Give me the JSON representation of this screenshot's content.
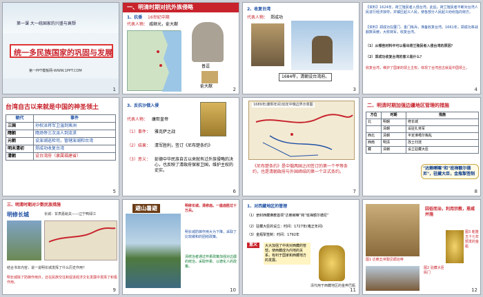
{
  "s1": {
    "lesson": "第一课  大一统国家的兴盛与衰颓",
    "title": "统一多民族国家的巩固与发展",
    "footer": "第一PPT模板网-WWW.1PPT.COM",
    "num": "1"
  },
  "s2": {
    "header": "一、明清时期对抗外族侵略",
    "item": "1、抗倭",
    "date": "16世纪中期",
    "rep_label": "代表人物：",
    "rep": "戚继光，俞大猷",
    "cap1": "普逗",
    "cap2": "俞大猷",
    "num": "2"
  },
  "s3": {
    "item": "2、收复台湾",
    "rep_label": "代表人物：",
    "rep": "郑成功",
    "caption": "1684年，清朝设台湾府。",
    "num": "3"
  },
  "s4": {
    "p1": "【资料】1624年，荷兰殖民者入侵台湾。此后，荷兰殖民者不断对台湾人民进行经济掠夺，并镇压起义人民，使各部分人民起义纷纷指向荷方。",
    "p2": "【资料】郑成功在厦门、金门练兵，准备收复台湾。1661年，郑成功率战舰数百艘，大败荷军，收复台湾。",
    "q1": "（1）从哪些材料中可以看出荷兰殖民者入侵台湾的原因？",
    "q2": "（2）郑成功收复台湾的意义是什么？",
    "a": "收复台湾，维护了国家的领土主权，体现了台湾自古就是中国领土。",
    "num": "4"
  },
  "s5": {
    "title": "台湾自古以来就是中国的神圣领土",
    "col1": "朝代",
    "col2": "事件",
    "rows": [
      [
        "三国",
        "孙权派将军卫温到夷洲"
      ],
      [
        "隋朝",
        "隋炀帝三次派人到流求"
      ],
      [
        "元朝",
        "设澎湖巡检司，管辖澎湖和台湾"
      ],
      [
        "明末清初",
        "郑成功收复台湾"
      ],
      [
        "清朝",
        "设台湾府（隶属福建省）"
      ]
    ],
    "num": "5"
  },
  "s6": {
    "item": "3、反抗沙俄入侵",
    "rep_label": "代表人物：",
    "rep": "康熙皇帝",
    "ev_label": "（1）事件：",
    "ev": "雅克萨之战",
    "res_label": "（2）结果：",
    "res": "清军胜利，签订《尼布楚条约》",
    "sig_label": "（3）意义：",
    "sig": "彭德中华民族自古以来就有过外族侵略的决心，也反映了清政府保家卫国，维护主权的史实。",
    "num": "6"
  },
  "s7": {
    "map_title": "1689年(康熙年间)划定中俄边界示意图",
    "text": "《尼布楚条约》是中俄两国之间签订的第一个平等条约，也是清朝政府与外国缔结的第一个正式条约。",
    "num": "7"
  },
  "s8": {
    "header": "二、明清时期加强边疆地区管理的措施",
    "cols": [
      "方位",
      "时期",
      "措施"
    ],
    "rows": [
      [
        "北",
        "明朝",
        "修长城"
      ],
      [
        "",
        "清朝",
        "设驻扎将军"
      ],
      [
        "西北",
        "清朝",
        "平定准噶尔叛乱"
      ],
      [
        "西南",
        "明清",
        "改土归流"
      ],
      [
        "藏",
        "清朝",
        "设立驻藏大臣"
      ]
    ],
    "bubble": "\"达赖喇嘛\"和\"班禅额尔德尼\"，驻藏大臣，金瓶掣签制",
    "num": "8"
  },
  "s9": {
    "header": "三、明清时期对少数民族措施",
    "title": "明修长城",
    "side": "长城：甘肃嘉峪关——辽宁鸭绿江",
    "q": "结合书本内容，说一说明长城发挥了什么历史作用？",
    "a": "明长城除了防御作用外，还在民族交往和促进经济文化发展中发挥了积极作用。",
    "num": "9"
  },
  "s10": {
    "sign": "避山暑避",
    "t1": "明修长城，清修庙。一座庙胜过十万兵。",
    "t2": "明长城防御作用大为下降，采取了比较缓和的团结政策。",
    "t3": "清统治者通过怀柔政策加强对边疆的统治，采取怀柔、以德化人的政策。",
    "num": "10"
  },
  "s11": {
    "item": "1、对西藏地区的管理",
    "l1": "（1）册封西藏佛教首领“达赖喇嘛”和“班禅额尔德尼”",
    "l2": "（2）驻藏大臣的设立：时间：1727年(雍正年间)",
    "l3": "（3）金瓶掣签制：时间：1792年",
    "sig_label": "意义",
    "sig": "大大加强了中央对西藏的管辖，使西藏成为内地的关系，有利于国家和西藏地方的发展。",
    "cap": "清代用于西藏地区的金奔巴瓶",
    "num": "11"
  },
  "s12": {
    "banner": "因俗而治，利用宗教，恩威并施",
    "cap1": "图1 达赖五世觐见顺治帝",
    "cap2": "图2 驻藏大臣衙门",
    "cap3": "图3 乾隆五十七年颁发的金瓶",
    "num": "12"
  }
}
